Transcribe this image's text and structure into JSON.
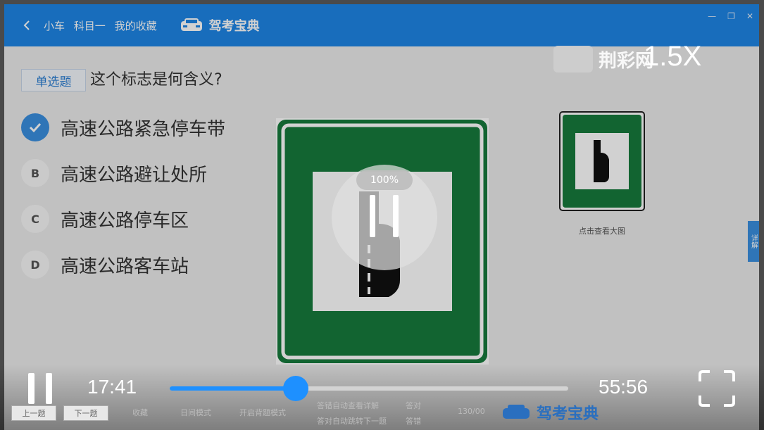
{
  "titlebar": {
    "crumb": [
      "小车",
      "科目一",
      "我的收藏"
    ],
    "brand": "驾考宝典"
  },
  "question": {
    "type": "单选题",
    "text": "这个标志是何含义?",
    "options": [
      {
        "mark": "",
        "label": "高速公路紧急停车带",
        "selected": true
      },
      {
        "mark": "B",
        "label": "高速公路避让处所",
        "selected": false
      },
      {
        "mark": "C",
        "label": "高速公路停车区",
        "selected": false
      },
      {
        "mark": "D",
        "label": "高速公路客车站",
        "selected": false
      }
    ],
    "thumb_caption": "点击查看大图",
    "side_tab": "详解"
  },
  "overlay": {
    "watermark": "荆彩网",
    "speed": "1.5X",
    "buffer_percent": "100%"
  },
  "player": {
    "current_time": "17:41",
    "total_time": "55:56",
    "progress_fraction": 0.316
  },
  "bottom_bar": {
    "prev": "上一题",
    "next": "下一题",
    "items": [
      "收藏",
      "日间模式",
      "开启背题模式",
      "答错自动查看详解",
      "答对自动跳转下一题",
      "答对",
      "答错",
      "130/00"
    ],
    "brand": "驾考宝典"
  },
  "colors": {
    "accent": "#1e86e6",
    "progress": "#1e90ff",
    "sign_green": "#167a3c"
  }
}
